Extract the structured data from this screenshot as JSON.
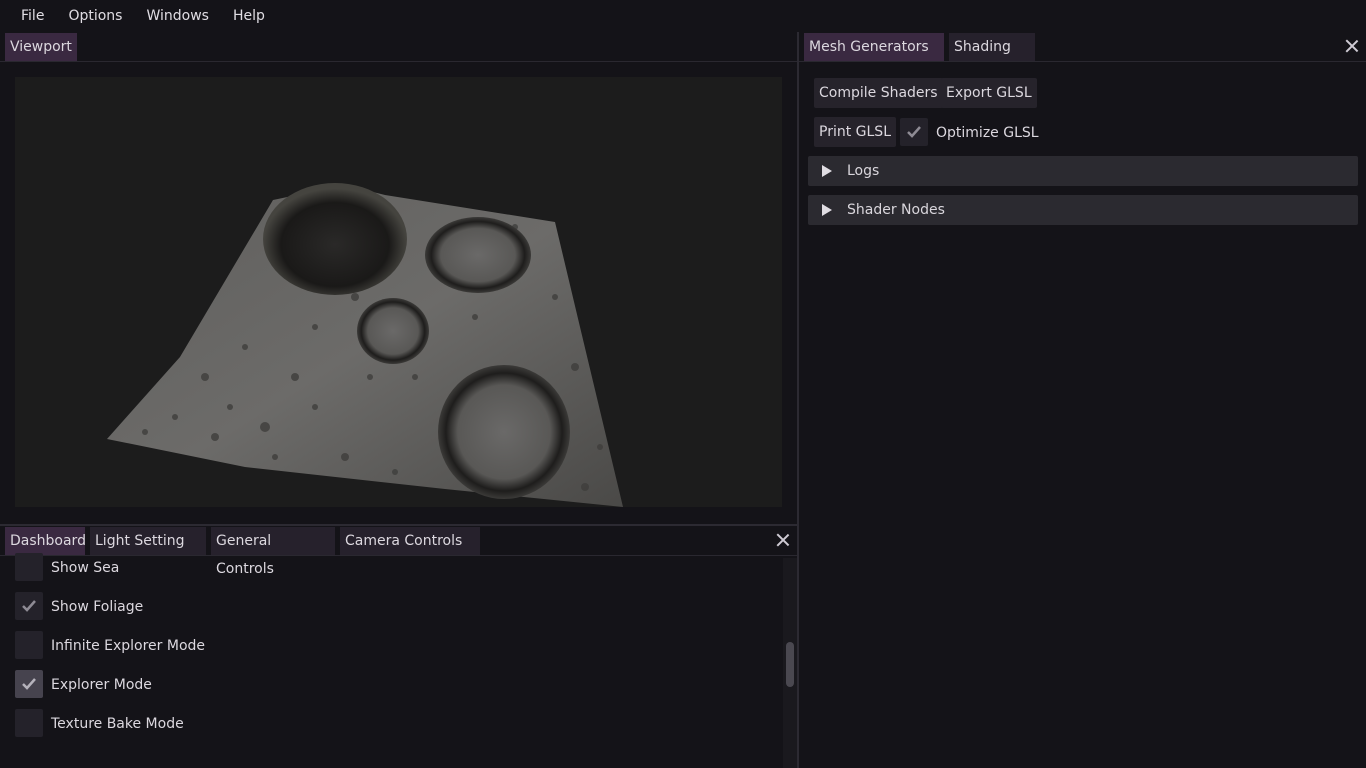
{
  "menu": [
    "File",
    "Options",
    "Windows",
    "Help"
  ],
  "viewport_panel": {
    "tabs": [
      {
        "label": "Viewport",
        "active": true
      }
    ]
  },
  "right_panel": {
    "tabs": [
      {
        "label": "Mesh Generators",
        "active": true
      },
      {
        "label": "Shading",
        "active": false
      }
    ],
    "buttons": {
      "compile_shaders": "Compile Shaders",
      "export_glsl": "Export GLSL",
      "print_glsl": "Print GLSL"
    },
    "optimize_glsl": {
      "label": "Optimize GLSL",
      "checked": true
    },
    "sections": [
      {
        "label": "Logs",
        "expanded": false
      },
      {
        "label": "Shader Nodes",
        "expanded": false
      }
    ]
  },
  "bottom_panel": {
    "tabs": [
      {
        "label": "Dashboard",
        "active": true
      },
      {
        "label": "Light Setting",
        "active": false
      },
      {
        "label": "General Controls",
        "active": false
      },
      {
        "label": "Camera Controls",
        "active": false
      }
    ],
    "options": [
      {
        "label": "Show Sea",
        "checked": false
      },
      {
        "label": "Show Foliage",
        "checked": true
      },
      {
        "label": "Infinite Explorer Mode",
        "checked": false
      },
      {
        "label": "Explorer Mode",
        "checked": true
      },
      {
        "label": "Texture Bake Mode",
        "checked": false
      }
    ]
  },
  "colors": {
    "background": "#141318",
    "tab_active": "#3a2941",
    "tab_inactive": "#26212c",
    "viewport_bg": "#1c1c1c"
  }
}
